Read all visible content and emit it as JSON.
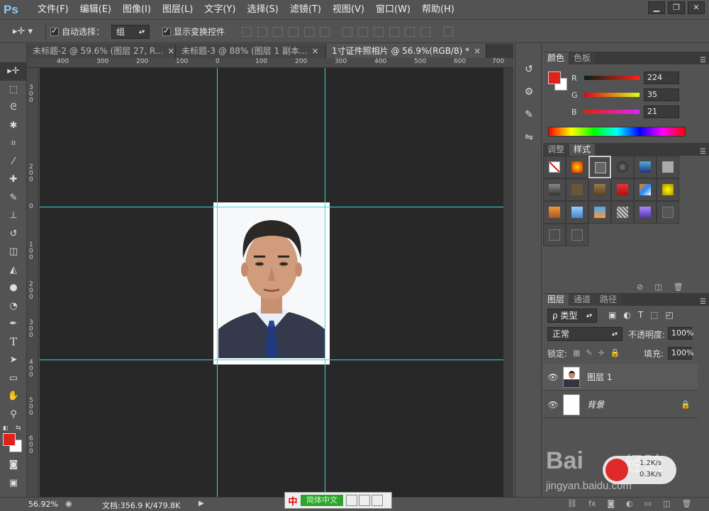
{
  "app": {
    "logo": "Ps"
  },
  "menus": [
    "文件(F)",
    "编辑(E)",
    "图像(I)",
    "图层(L)",
    "文字(Y)",
    "选择(S)",
    "滤镜(T)",
    "视图(V)",
    "窗口(W)",
    "帮助(H)"
  ],
  "window_controls": [
    "▁",
    "❐",
    "✕"
  ],
  "options": {
    "auto_select_label": "自动选择：",
    "auto_select_value": "组",
    "show_transform_label": "显示变换控件"
  },
  "tabs": [
    {
      "label": "未标题-2 @ 59.6% (图层 27, R...",
      "close": "×"
    },
    {
      "label": "未标题-3 @ 88% (图层 1 副本...",
      "close": "×"
    },
    {
      "label": "1寸证件照相片 @ 56.9%(RGB/8) *",
      "close": "×"
    }
  ],
  "ruler_h": [
    "400",
    "300",
    "200",
    "100",
    "0",
    "100",
    "200",
    "300",
    "400",
    "500",
    "600",
    "700"
  ],
  "ruler_v": [
    "300",
    "200",
    "100",
    "0",
    "100",
    "200",
    "300",
    "400",
    "500",
    "600"
  ],
  "color_panel": {
    "tabs": [
      "颜色",
      "色板"
    ],
    "fg_color": "#e0231a",
    "bg_color": "#ffffff",
    "channels": [
      {
        "label": "R",
        "value": "224"
      },
      {
        "label": "G",
        "value": "35"
      },
      {
        "label": "B",
        "value": "21"
      }
    ]
  },
  "styles_panel": {
    "tabs": [
      "调整",
      "样式"
    ]
  },
  "layers_panel": {
    "tabs": [
      "图层",
      "通道",
      "路径"
    ],
    "kind_label": "ρ 类型",
    "blend_mode": "正常",
    "opacity_label": "不透明度:",
    "opacity_value": "100%",
    "lock_label": "锁定:",
    "fill_label": "填充:",
    "fill_value": "100%",
    "layers": [
      {
        "name": "图层 1"
      },
      {
        "name": "背景",
        "locked": true
      }
    ]
  },
  "status": {
    "zoom": "56.92%",
    "doc": "文档:356.9 K/479.8K"
  },
  "taskbar": {
    "ime_label": "中",
    "ime_field": "简体中文"
  },
  "watermark": {
    "text1": "Bai",
    "text2": "经验",
    "url": "jingyan.baidu.com",
    "net_up": "1.2K/s",
    "net_down": "0.3K/s"
  }
}
